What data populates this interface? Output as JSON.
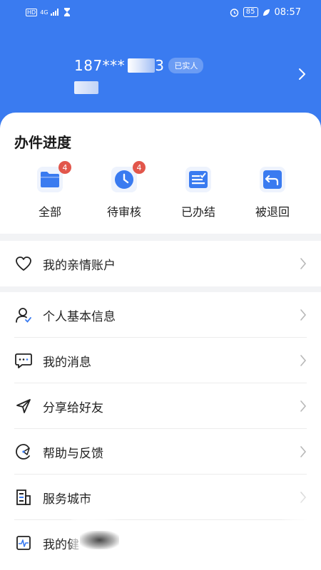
{
  "status_bar": {
    "left_indicators": "HD",
    "network": "4G",
    "battery": "85",
    "time": "08:57"
  },
  "profile": {
    "phone_visible": "187***",
    "phone_tail": "3",
    "verified_badge": "已实人"
  },
  "progress": {
    "title": "办件进度",
    "items": [
      {
        "label": "全部",
        "badge": "4",
        "icon": "folder-icon"
      },
      {
        "label": "待审核",
        "badge": "4",
        "icon": "clock-icon"
      },
      {
        "label": "已办结",
        "badge": "",
        "icon": "checklist-icon"
      },
      {
        "label": "被退回",
        "badge": "",
        "icon": "return-icon"
      }
    ]
  },
  "family_section": {
    "items": [
      {
        "label": "我的亲情账户",
        "icon": "heart-icon"
      }
    ]
  },
  "menu_section": {
    "items": [
      {
        "label": "个人基本信息",
        "icon": "user-icon"
      },
      {
        "label": "我的消息",
        "icon": "message-icon"
      },
      {
        "label": "分享给好友",
        "icon": "share-icon"
      },
      {
        "label": "帮助与反馈",
        "icon": "help-icon"
      },
      {
        "label": "服务城市",
        "icon": "city-icon"
      },
      {
        "label": "我的健",
        "icon": "health-icon"
      }
    ]
  },
  "colors": {
    "header_blue": "#3a7bf0",
    "accent_blue": "#3a7bf0",
    "badge_red": "#e2564b"
  }
}
